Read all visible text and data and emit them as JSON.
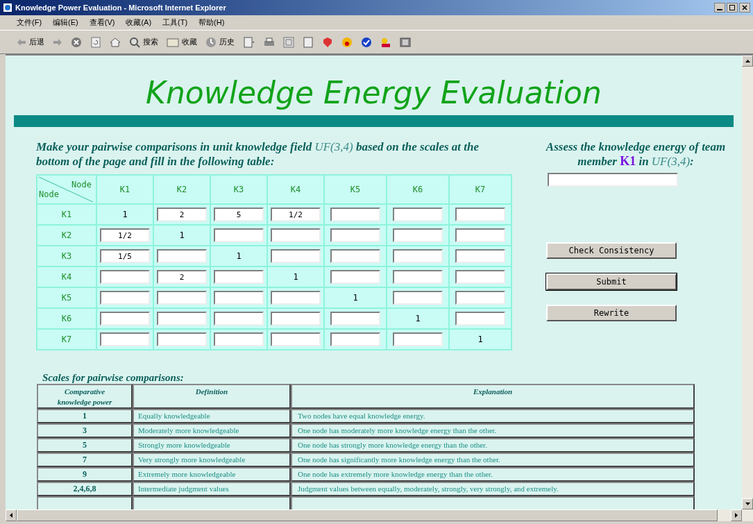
{
  "window": {
    "title": "Knowledge Power Evaluation - Microsoft Internet Explorer"
  },
  "menu": [
    "文件(F)",
    "编辑(E)",
    "查看(V)",
    "收藏(A)",
    "工具(T)",
    "帮助(H)"
  ],
  "toolbar": {
    "back": "后退",
    "search": "搜索",
    "favorites": "收藏",
    "history": "历史"
  },
  "page": {
    "heading": "Knowledge Energy Evaluation",
    "instruction_parts": [
      "Make your pairwise comparisons in unit knowledge field ",
      "UF(3,4)",
      " based on the scales at the bottom of the page and fill in the following table:"
    ],
    "matrix": {
      "corner_top": "Node",
      "corner_bottom": "Node",
      "columns": [
        "K1",
        "K2",
        "K3",
        "K4",
        "K5",
        "K6",
        "K7"
      ],
      "rows": [
        {
          "label": "K1",
          "cells": [
            {
              "kind": "fixed",
              "text": "1"
            },
            {
              "kind": "input",
              "value": "2"
            },
            {
              "kind": "input",
              "value": "5"
            },
            {
              "kind": "input",
              "value": "1/2"
            },
            {
              "kind": "input"
            },
            {
              "kind": "input"
            },
            {
              "kind": "input"
            }
          ]
        },
        {
          "label": "K2",
          "cells": [
            {
              "kind": "input",
              "value": "1/2"
            },
            {
              "kind": "fixed",
              "text": "1"
            },
            {
              "kind": "input"
            },
            {
              "kind": "input"
            },
            {
              "kind": "input"
            },
            {
              "kind": "input"
            },
            {
              "kind": "input"
            }
          ]
        },
        {
          "label": "K3",
          "cells": [
            {
              "kind": "input",
              "value": "1/5"
            },
            {
              "kind": "input"
            },
            {
              "kind": "fixed",
              "text": "1"
            },
            {
              "kind": "input"
            },
            {
              "kind": "input"
            },
            {
              "kind": "input"
            },
            {
              "kind": "input"
            }
          ]
        },
        {
          "label": "K4",
          "cells": [
            {
              "kind": "input"
            },
            {
              "kind": "input",
              "value": "2"
            },
            {
              "kind": "input"
            },
            {
              "kind": "fixed",
              "text": "1"
            },
            {
              "kind": "input"
            },
            {
              "kind": "input"
            },
            {
              "kind": "input"
            }
          ]
        },
        {
          "label": "K5",
          "cells": [
            {
              "kind": "input"
            },
            {
              "kind": "input"
            },
            {
              "kind": "input"
            },
            {
              "kind": "input"
            },
            {
              "kind": "fixed",
              "text": "1"
            },
            {
              "kind": "input"
            },
            {
              "kind": "input"
            }
          ]
        },
        {
          "label": "K6",
          "cells": [
            {
              "kind": "input"
            },
            {
              "kind": "input"
            },
            {
              "kind": "input"
            },
            {
              "kind": "input"
            },
            {
              "kind": "input"
            },
            {
              "kind": "fixed",
              "text": "1"
            },
            {
              "kind": "input"
            }
          ]
        },
        {
          "label": "K7",
          "cells": [
            {
              "kind": "input"
            },
            {
              "kind": "input"
            },
            {
              "kind": "input"
            },
            {
              "kind": "input"
            },
            {
              "kind": "input"
            },
            {
              "kind": "input"
            },
            {
              "kind": "fixed",
              "text": "1"
            }
          ]
        }
      ]
    },
    "assess_parts": [
      "Assess the knowledge energy of team member ",
      "K1",
      " in ",
      "UF(3,4)",
      ":"
    ],
    "buttons": [
      {
        "label": "Check Consistency",
        "focused": false
      },
      {
        "label": "Submit",
        "focused": true
      },
      {
        "label": "Rewrite",
        "focused": false
      }
    ],
    "scales": {
      "title": "Scales for pairwise comparisons:",
      "columns": [
        "Comparative knowledge power",
        "Definition",
        "Explanation"
      ],
      "rows": [
        {
          "power": "1",
          "definition": "Equally knowledgeable",
          "explanation": "Two nodes have equal knowledge energy."
        },
        {
          "power": "3",
          "definition": "Moderately more knowledgeable",
          "explanation": "One node has moderately more knowledge energy than the other."
        },
        {
          "power": "5",
          "definition": "Strongly more knowledgeable",
          "explanation": "One node has strongly more knowledge energy than the other."
        },
        {
          "power": "7",
          "definition": "Very strongly more knowledgeable",
          "explanation": "One node has significantly more knowledge energy than the other."
        },
        {
          "power": "9",
          "definition": "Extremely more knowledgeable",
          "explanation": "One node has extremely more knowledge energy than the other."
        },
        {
          "power": "2,4,6,8",
          "definition": "Intermediate judgment values",
          "explanation": "Judgment values between equally, moderately, strongly, very strongly, and extremely."
        }
      ]
    }
  }
}
